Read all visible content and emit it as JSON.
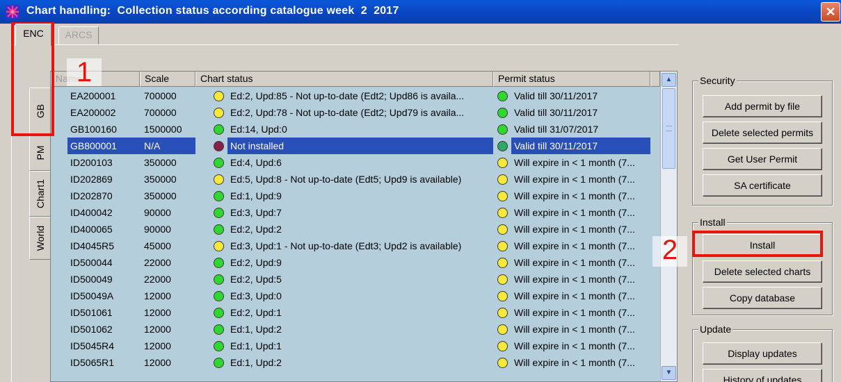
{
  "window": {
    "title": "Chart handling:  Collection status according catalogue week  2  2017",
    "close_label": "✕"
  },
  "top_tabs": [
    {
      "label": "ENC",
      "active": true
    },
    {
      "label": "ARCS",
      "active": false
    }
  ],
  "side_tabs": [
    "GB",
    "PM",
    "Chart1",
    "World"
  ],
  "table": {
    "columns": [
      "Name",
      "Scale",
      "Chart status",
      "Permit status"
    ],
    "rows": [
      {
        "name": "EA200001",
        "scale": "700000",
        "chart_status": "Ed:2, Upd:85 - Not up-to-date (Edt2; Upd86 is availa...",
        "chart_dot": "#f5e83a",
        "permit_status": "Valid till 30/11/2017",
        "permit_dot": "#2ed82e"
      },
      {
        "name": "EA200002",
        "scale": "700000",
        "chart_status": "Ed:2, Upd:78 - Not up-to-date (Edt2; Upd79 is availa...",
        "chart_dot": "#f5e83a",
        "permit_status": "Valid till 30/11/2017",
        "permit_dot": "#2ed82e"
      },
      {
        "name": "GB100160",
        "scale": "1500000",
        "chart_status": "Ed:14, Upd:0",
        "chart_dot": "#2ed82e",
        "permit_status": "Valid till 31/07/2017",
        "permit_dot": "#2ed82e"
      },
      {
        "name": "GB800001",
        "scale": "N/A",
        "chart_status": "Not installed",
        "chart_dot": "#8a1f4a",
        "permit_status": "Valid till 30/11/2017",
        "permit_dot": "#2ea86a",
        "selected": true
      },
      {
        "name": "ID200103",
        "scale": "350000",
        "chart_status": "Ed:4, Upd:6",
        "chart_dot": "#2ed82e",
        "permit_status": "Will expire in < 1 month (7...",
        "permit_dot": "#f5e83a"
      },
      {
        "name": "ID202869",
        "scale": "350000",
        "chart_status": "Ed:5, Upd:8 - Not up-to-date (Edt5; Upd9 is available)",
        "chart_dot": "#f5e83a",
        "permit_status": "Will expire in < 1 month (7...",
        "permit_dot": "#f5e83a"
      },
      {
        "name": "ID202870",
        "scale": "350000",
        "chart_status": "Ed:1, Upd:9",
        "chart_dot": "#2ed82e",
        "permit_status": "Will expire in < 1 month (7...",
        "permit_dot": "#f5e83a"
      },
      {
        "name": "ID400042",
        "scale": "90000",
        "chart_status": "Ed:3, Upd:7",
        "chart_dot": "#2ed82e",
        "permit_status": "Will expire in < 1 month (7...",
        "permit_dot": "#f5e83a"
      },
      {
        "name": "ID400065",
        "scale": "90000",
        "chart_status": "Ed:2, Upd:2",
        "chart_dot": "#2ed82e",
        "permit_status": "Will expire in < 1 month (7...",
        "permit_dot": "#f5e83a"
      },
      {
        "name": "ID4045R5",
        "scale": "45000",
        "chart_status": "Ed:3, Upd:1 - Not up-to-date (Edt3; Upd2 is available)",
        "chart_dot": "#f5e83a",
        "permit_status": "Will expire in < 1 month (7...",
        "permit_dot": "#f5e83a"
      },
      {
        "name": "ID500044",
        "scale": "22000",
        "chart_status": "Ed:2, Upd:9",
        "chart_dot": "#2ed82e",
        "permit_status": "Will expire in < 1 month (7...",
        "permit_dot": "#f5e83a"
      },
      {
        "name": "ID500049",
        "scale": "22000",
        "chart_status": "Ed:2, Upd:5",
        "chart_dot": "#2ed82e",
        "permit_status": "Will expire in < 1 month (7...",
        "permit_dot": "#f5e83a"
      },
      {
        "name": "ID50049A",
        "scale": "12000",
        "chart_status": "Ed:3, Upd:0",
        "chart_dot": "#2ed82e",
        "permit_status": "Will expire in < 1 month (7...",
        "permit_dot": "#f5e83a"
      },
      {
        "name": "ID501061",
        "scale": "12000",
        "chart_status": "Ed:2, Upd:1",
        "chart_dot": "#2ed82e",
        "permit_status": "Will expire in < 1 month (7...",
        "permit_dot": "#f5e83a"
      },
      {
        "name": "ID501062",
        "scale": "12000",
        "chart_status": "Ed:1, Upd:2",
        "chart_dot": "#2ed82e",
        "permit_status": "Will expire in < 1 month (7...",
        "permit_dot": "#f5e83a"
      },
      {
        "name": "ID5045R4",
        "scale": "12000",
        "chart_status": "Ed:1, Upd:1",
        "chart_dot": "#2ed82e",
        "permit_status": "Will expire in < 1 month (7...",
        "permit_dot": "#f5e83a"
      },
      {
        "name": "ID5065R1",
        "scale": "12000",
        "chart_status": "Ed:1, Upd:2",
        "chart_dot": "#2ed82e",
        "permit_status": "Will expire in < 1 month (7...",
        "permit_dot": "#f5e83a"
      }
    ]
  },
  "security": {
    "title": "Security",
    "buttons": [
      "Add permit by file",
      "Delete selected permits",
      "Get User Permit",
      "SA certificate"
    ]
  },
  "install": {
    "title": "Install",
    "buttons": [
      "Install",
      "Delete selected charts",
      "Copy database"
    ]
  },
  "update": {
    "title": "Update",
    "buttons": [
      "Display updates",
      "History of updates"
    ]
  },
  "annotations": {
    "step1": "1",
    "step2": "2",
    "color": "#e8150e"
  }
}
